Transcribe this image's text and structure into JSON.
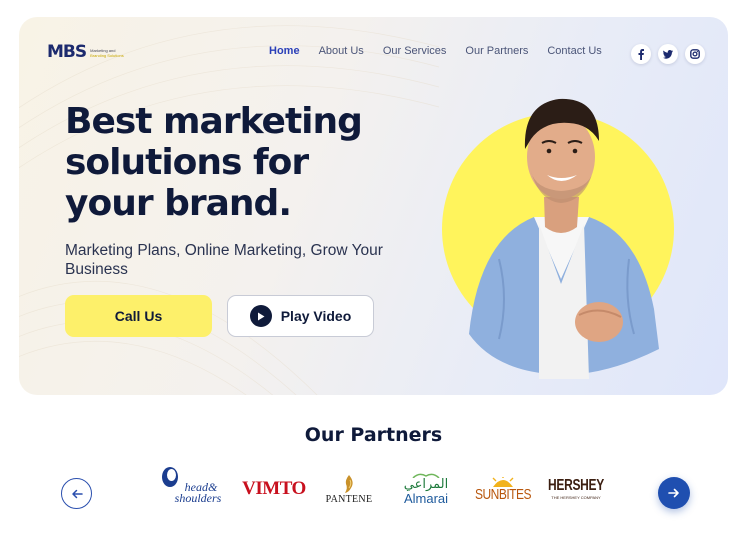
{
  "brand": {
    "logo_mark": "MBS",
    "tagline_line1": "Marketing and",
    "tagline_line2": "Branding Solutions"
  },
  "nav": {
    "items": [
      {
        "label": "Home",
        "active": true
      },
      {
        "label": "About Us",
        "active": false
      },
      {
        "label": "Our Services",
        "active": false
      },
      {
        "label": "Our Partners",
        "active": false
      },
      {
        "label": "Contact Us",
        "active": false
      }
    ],
    "socials": [
      {
        "icon": "facebook-icon",
        "glyph": "f"
      },
      {
        "icon": "twitter-icon",
        "glyph": "t"
      },
      {
        "icon": "instagram-icon",
        "glyph": "◎"
      }
    ]
  },
  "hero": {
    "headline": "Best marketing solutions for your brand.",
    "subline": "Marketing Plans, Online Marketing, Grow Your Business",
    "call_label": "Call Us",
    "play_label": "Play Video",
    "colors": {
      "accent_yellow": "#fdf06a",
      "circle_yellow": "#fff45c",
      "navy": "#0f1a3a",
      "nav_active": "#2a3fb8"
    }
  },
  "partners": {
    "title": "Our Partners",
    "logos": {
      "head_shoulders_1": "head&",
      "head_shoulders_2": "shoulders",
      "vimto": "VIMTO",
      "pantene": "PANTENE",
      "almarai_ar": "المراعي",
      "almarai_en": "Almarai",
      "sunbites": "SUNBITES",
      "hershey": "HERSHEY",
      "hershey_sub": "THE HERSHEY COMPANY"
    }
  }
}
